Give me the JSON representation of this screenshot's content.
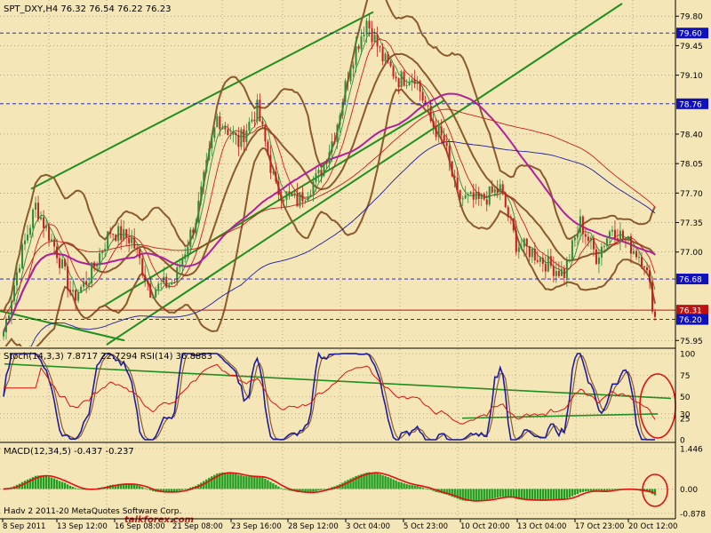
{
  "colors": {
    "background": "#f5e6b8",
    "bull_candle": "#2e8b3a",
    "bear_candle": "#c81e1e",
    "bollinger": "#8a5a2b",
    "ma_fast": "#2e8b3a",
    "ma_slow": "#c81e1e",
    "ma_magenta": "#b0209c",
    "ma_blue": "#1c1ca0",
    "trend_green": "#1f8f1f",
    "stoch_main": "#1c1ca0",
    "rsi_line": "#e01010",
    "macd_hist": "#1f9f1f",
    "macd_signal": "#e01010",
    "price_box_blue": "#1010c0",
    "price_box_red": "#c01010",
    "annotation_circle": "#e01010"
  },
  "main_panel": {
    "header": "SPT_DXY,H4  76.32 76.54 76.22 76.23",
    "price_labels": [
      "79.80",
      "79.45",
      "79.10",
      "78.40",
      "78.05",
      "77.70",
      "77.35",
      "77.00",
      "75.95"
    ],
    "price_boxes": [
      {
        "label": "79.60",
        "value": 79.6,
        "style": "blue"
      },
      {
        "label": "78.76",
        "value": 78.76,
        "style": "blue"
      },
      {
        "label": "76.68",
        "value": 76.68,
        "style": "blue"
      },
      {
        "label": "76.31",
        "value": 76.31,
        "style": "red"
      },
      {
        "label": "76.20",
        "value": 76.2,
        "style": "blue"
      }
    ]
  },
  "stoch_panel": {
    "header": "Stoch(14,3,3) 7.8717 22.7294  RSI(14) 36.8883",
    "scale_labels": [
      "100",
      "75",
      "50",
      "30",
      "25",
      "0"
    ]
  },
  "macd_panel": {
    "header": "MACD(12,34,5) -0.437 -0.237",
    "scale_labels": [
      "1.446",
      "0.00",
      "-0.878"
    ],
    "footer_left": "H",
    "watermark": "adv 2 2011-20  MetaQuotes Software Corp.",
    "watermark_brand": "talkforex.com"
  },
  "time_labels": [
    "8 Sep 2011",
    "13 Sep 12:00",
    "16 Sep 08:00",
    "21 Sep 08:00",
    "23 Sep 16:00",
    "28 Sep 12:00",
    "3 Oct 04:00",
    "5 Oct 23:00",
    "10 Oct 20:00",
    "13 Oct 04:00",
    "17 Oct 23:00",
    "20 Oct 12:00"
  ],
  "chart_data": [
    {
      "type": "candlestick",
      "title": "SPT_DXY,H4",
      "ylim": [
        75.9,
        79.95
      ],
      "x_range": [
        "8 Sep 2011",
        "20 Oct 12:00"
      ],
      "series": [
        {
          "name": "Close",
          "x": [
            "8 Sep 2011",
            "13 Sep 12:00",
            "16 Sep 08:00",
            "21 Sep 08:00",
            "23 Sep 16:00",
            "28 Sep 12:00",
            "3 Oct 04:00",
            "5 Oct 23:00",
            "10 Oct 20:00",
            "13 Oct 04:00",
            "17 Oct 23:00",
            "20 Oct 12:00"
          ],
          "values": [
            76.05,
            77.3,
            76.6,
            78.2,
            78.3,
            77.75,
            79.65,
            78.95,
            77.6,
            76.95,
            77.05,
            76.23
          ]
        }
      ]
    },
    {
      "type": "line",
      "title": "Stoch(14,3,3) 7.8717 22.7294 RSI(14) 36.8883",
      "ylim": [
        0,
        100
      ],
      "series": [
        {
          "name": "Stoch",
          "values": [
            75,
            15,
            90,
            20,
            80,
            25,
            95,
            10,
            30,
            15,
            85,
            8
          ]
        },
        {
          "name": "RSI",
          "values": [
            70,
            45,
            65,
            55,
            60,
            48,
            68,
            40,
            38,
            36,
            55,
            37
          ]
        }
      ]
    },
    {
      "type": "bar",
      "title": "MACD(12,34,5) -0.437 -0.237",
      "ylim": [
        -0.878,
        1.446
      ],
      "series": [
        {
          "name": "MACD",
          "values": [
            0.2,
            0.7,
            -0.1,
            0.3,
            0.9,
            0.3,
            1.1,
            0.4,
            -0.6,
            -0.7,
            -0.1,
            -0.437
          ]
        },
        {
          "name": "Signal",
          "values": [
            0.1,
            0.6,
            0.0,
            0.2,
            0.8,
            0.4,
            1.0,
            0.6,
            -0.3,
            -0.6,
            -0.3,
            -0.237
          ]
        }
      ]
    }
  ]
}
